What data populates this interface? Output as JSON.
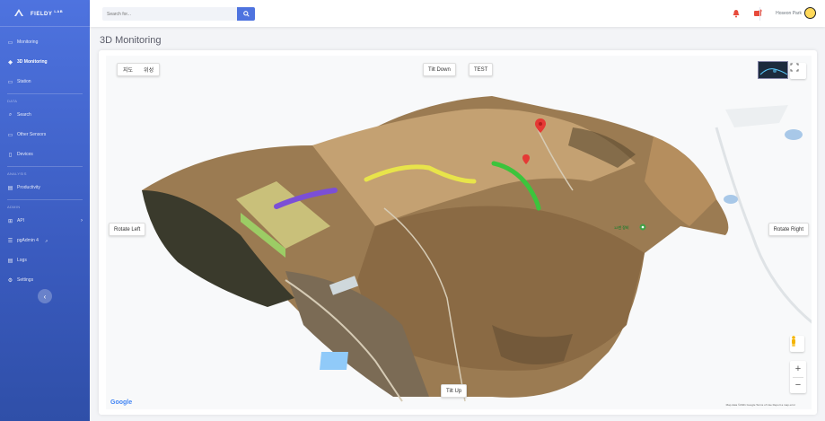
{
  "sidebar": {
    "brand": "FIELDY",
    "brand_sup": "LAB",
    "items": [
      {
        "label": "Monitoring",
        "icon": "desktop-icon"
      },
      {
        "label": "3D Monitoring",
        "icon": "cube-icon",
        "active": true
      },
      {
        "label": "Station",
        "icon": "station-icon"
      }
    ],
    "heading_data": "DATA",
    "items_data": [
      {
        "label": "Search",
        "icon": "search-icon"
      },
      {
        "label": "Other Sensors",
        "icon": "sensor-icon"
      },
      {
        "label": "Devices",
        "icon": "device-icon"
      }
    ],
    "heading_analysis": "ANALYSIS",
    "items_analysis": [
      {
        "label": "Productivity",
        "icon": "chart-icon"
      }
    ],
    "heading_admin": "ADMIN",
    "items_admin": [
      {
        "label": "API",
        "icon": "api-icon"
      },
      {
        "label": "pgAdmin 4",
        "icon": "database-icon"
      },
      {
        "label": "Logs",
        "icon": "log-icon"
      },
      {
        "label": "Settings",
        "icon": "gear-icon"
      }
    ],
    "toggle": "‹"
  },
  "topbar": {
    "search_placeholder": "Search for...",
    "user_name": "Hoseon Park"
  },
  "page": {
    "title": "3D Monitoring"
  },
  "map": {
    "layer_map": "지도",
    "layer_satellite": "위성",
    "tilt_down": "Tilt Down",
    "test": "TEST",
    "rotate_left": "Rotate Left",
    "rotate_right": "Rotate Right",
    "tilt_up": "Tilt Up",
    "google": "Google",
    "poi": "12번 장비",
    "attribution": "Map data ©2021 Google  Terms of Use  Report a map error",
    "zoom_in": "+",
    "zoom_out": "−"
  },
  "colors": {
    "sidebar": "#4e73df",
    "accent": "#4e73df",
    "alert": "#e74a3b",
    "track_purple": "#7b4fd6",
    "track_yellow": "#e8e44a",
    "track_green": "#3cc43c"
  }
}
